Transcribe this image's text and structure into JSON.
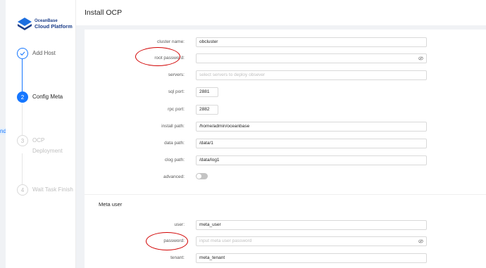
{
  "edge_tab": {
    "text": "nd"
  },
  "logo": {
    "line1": "OceanBase",
    "line2": "Cloud Platform"
  },
  "steps": [
    {
      "label": "Add Host",
      "number": "",
      "state": "done"
    },
    {
      "label": "Config Meta",
      "number": "2",
      "state": "active"
    },
    {
      "label": "OCP Deployment",
      "number": "3",
      "state": "wait"
    },
    {
      "label": "Wait Task Finish",
      "number": "4",
      "state": "wait"
    }
  ],
  "header": {
    "title": "Install OCP"
  },
  "form": {
    "cluster_name": {
      "label": "cluster name:",
      "value": "obcluster"
    },
    "root_password": {
      "label": "root password:",
      "value": ""
    },
    "servers": {
      "label": "servers:",
      "placeholder": "select servers to deploy obsever"
    },
    "sql_port": {
      "label": "sql port:",
      "value": "2881"
    },
    "rpc_port": {
      "label": "rpc port:",
      "value": "2882"
    },
    "install_path": {
      "label": "install path:",
      "value": "/home/admin/oceanbase"
    },
    "data_path": {
      "label": "data path:",
      "value": "/data/1"
    },
    "clog_path": {
      "label": "clog path:",
      "value": "/data/log1"
    },
    "advanced": {
      "label": "advanced:",
      "enabled": false
    }
  },
  "meta_user": {
    "section_title": "Meta user",
    "user": {
      "label": "user:",
      "value": "meta_user"
    },
    "password": {
      "label": "password:",
      "placeholder": "input meta user password"
    },
    "tenant": {
      "label": "tenant:",
      "value": "meta_tenant"
    }
  },
  "annotations": {
    "highlight_color": "#d10000"
  },
  "colors": {
    "accent": "#1677ff",
    "brand": "#1d3f8a"
  },
  "icons": {
    "logo": "oceanbase-logo-icon",
    "done_step": "check-icon",
    "password_toggle": "eye-icon"
  }
}
